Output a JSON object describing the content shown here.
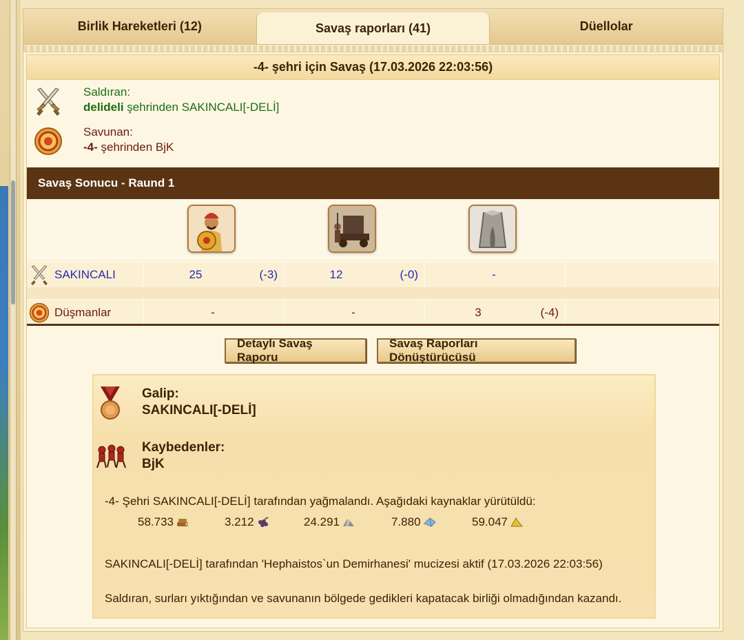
{
  "tabs": [
    {
      "label": "Birlik Hareketleri (12)",
      "active": false
    },
    {
      "label": "Savaş raporları (41)",
      "active": true
    },
    {
      "label": "Düellolar",
      "active": false
    }
  ],
  "report": {
    "title": "-4- şehri için Savaş (17.03.2026 22:03:56)",
    "attacker": {
      "role": "Saldıran:",
      "city": "delideli",
      "line_rest": " şehrinden SAKINCALI[-DELİ]"
    },
    "defender": {
      "role": "Savunan:",
      "city": "-4-",
      "line_rest": " şehrinden BjK"
    },
    "result_header": "Savaş Sonucu - Raund 1",
    "units": [
      "hoplite-unit-icon",
      "catapult-unit-icon",
      "wall-unit-icon"
    ],
    "rows": {
      "player": {
        "name": "SAKINCALI",
        "values": [
          {
            "count": "25",
            "loss": "(-3)"
          },
          {
            "count": "12",
            "loss": "(-0)"
          },
          {
            "count": "-",
            "loss": ""
          }
        ]
      },
      "enemy": {
        "name": "Düşmanlar",
        "values": [
          {
            "count": "-",
            "loss": ""
          },
          {
            "count": "-",
            "loss": ""
          },
          {
            "count": "3",
            "loss": "(-4)"
          }
        ]
      }
    },
    "buttons": {
      "detailed": "Detaylı Savaş Raporu",
      "converter": "Savaş Raporları Dönüştürücüsü"
    },
    "summary": {
      "winner_label": "Galip:",
      "winner_name": "SAKINCALI[-DELİ]",
      "loser_label": "Kaybedenler:",
      "loser_name": "BjK",
      "plunder_text": "-4- Şehri SAKINCALI[-DELİ] tarafından yağmalandı. Aşağıdaki kaynaklar yürütüldü:",
      "resources": [
        {
          "value": "58.733",
          "icon": "wood-icon"
        },
        {
          "value": "3.212",
          "icon": "grapes-icon"
        },
        {
          "value": "24.291",
          "icon": "marble-icon"
        },
        {
          "value": "7.880",
          "icon": "crystal-icon"
        },
        {
          "value": "59.047",
          "icon": "sulfur-icon"
        }
      ],
      "wonder_text": "SAKINCALI[-DELİ] tarafından 'Hephaistos`un Demirhanesi' mucizesi aktif (17.03.2026 22:03:56)",
      "reason_text": "Saldıran, surları yıktığından ve savunanın bölgede gedikleri kapatacak birliği olmadığından kazandı."
    }
  }
}
